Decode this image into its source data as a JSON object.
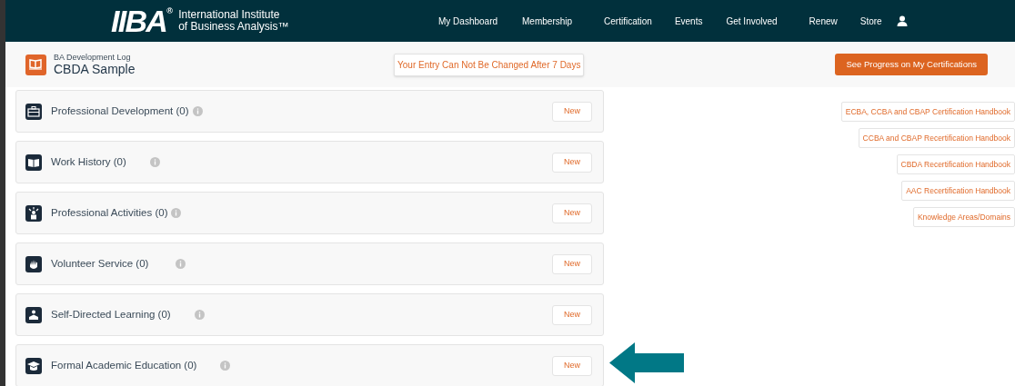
{
  "brand": {
    "mark": "IIBA",
    "registered": "®",
    "name_line1": "International Institute",
    "name_line2": "of Business Analysis™"
  },
  "nav": [
    "My Dashboard",
    "Membership",
    "Certification",
    "Events",
    "Get Involved",
    "Renew",
    "Store"
  ],
  "header": {
    "subtitle": "BA Development Log",
    "title": "CBDA Sample",
    "notice": "Your Entry Can Not Be Changed After 7 Days",
    "progress_button": "See Progress on My Certifications"
  },
  "sections": [
    {
      "label": "Professional Development (0)",
      "button": "New"
    },
    {
      "label": "Work History (0)",
      "button": "New"
    },
    {
      "label": "Professional Activities (0)",
      "button": "New"
    },
    {
      "label": "Volunteer Service (0)",
      "button": "New"
    },
    {
      "label": "Self-Directed Learning (0)",
      "button": "New"
    },
    {
      "label": "Formal Academic Education (0)",
      "button": "New"
    }
  ],
  "handbooks": [
    "ECBA, CCBA and CBAP Certification Handbook",
    "CCBA and CBAP Recertification Handbook",
    "CBDA Recertification Handbook",
    "AAC Recertification Handbook",
    "Knowledge Areas/Domains"
  ]
}
